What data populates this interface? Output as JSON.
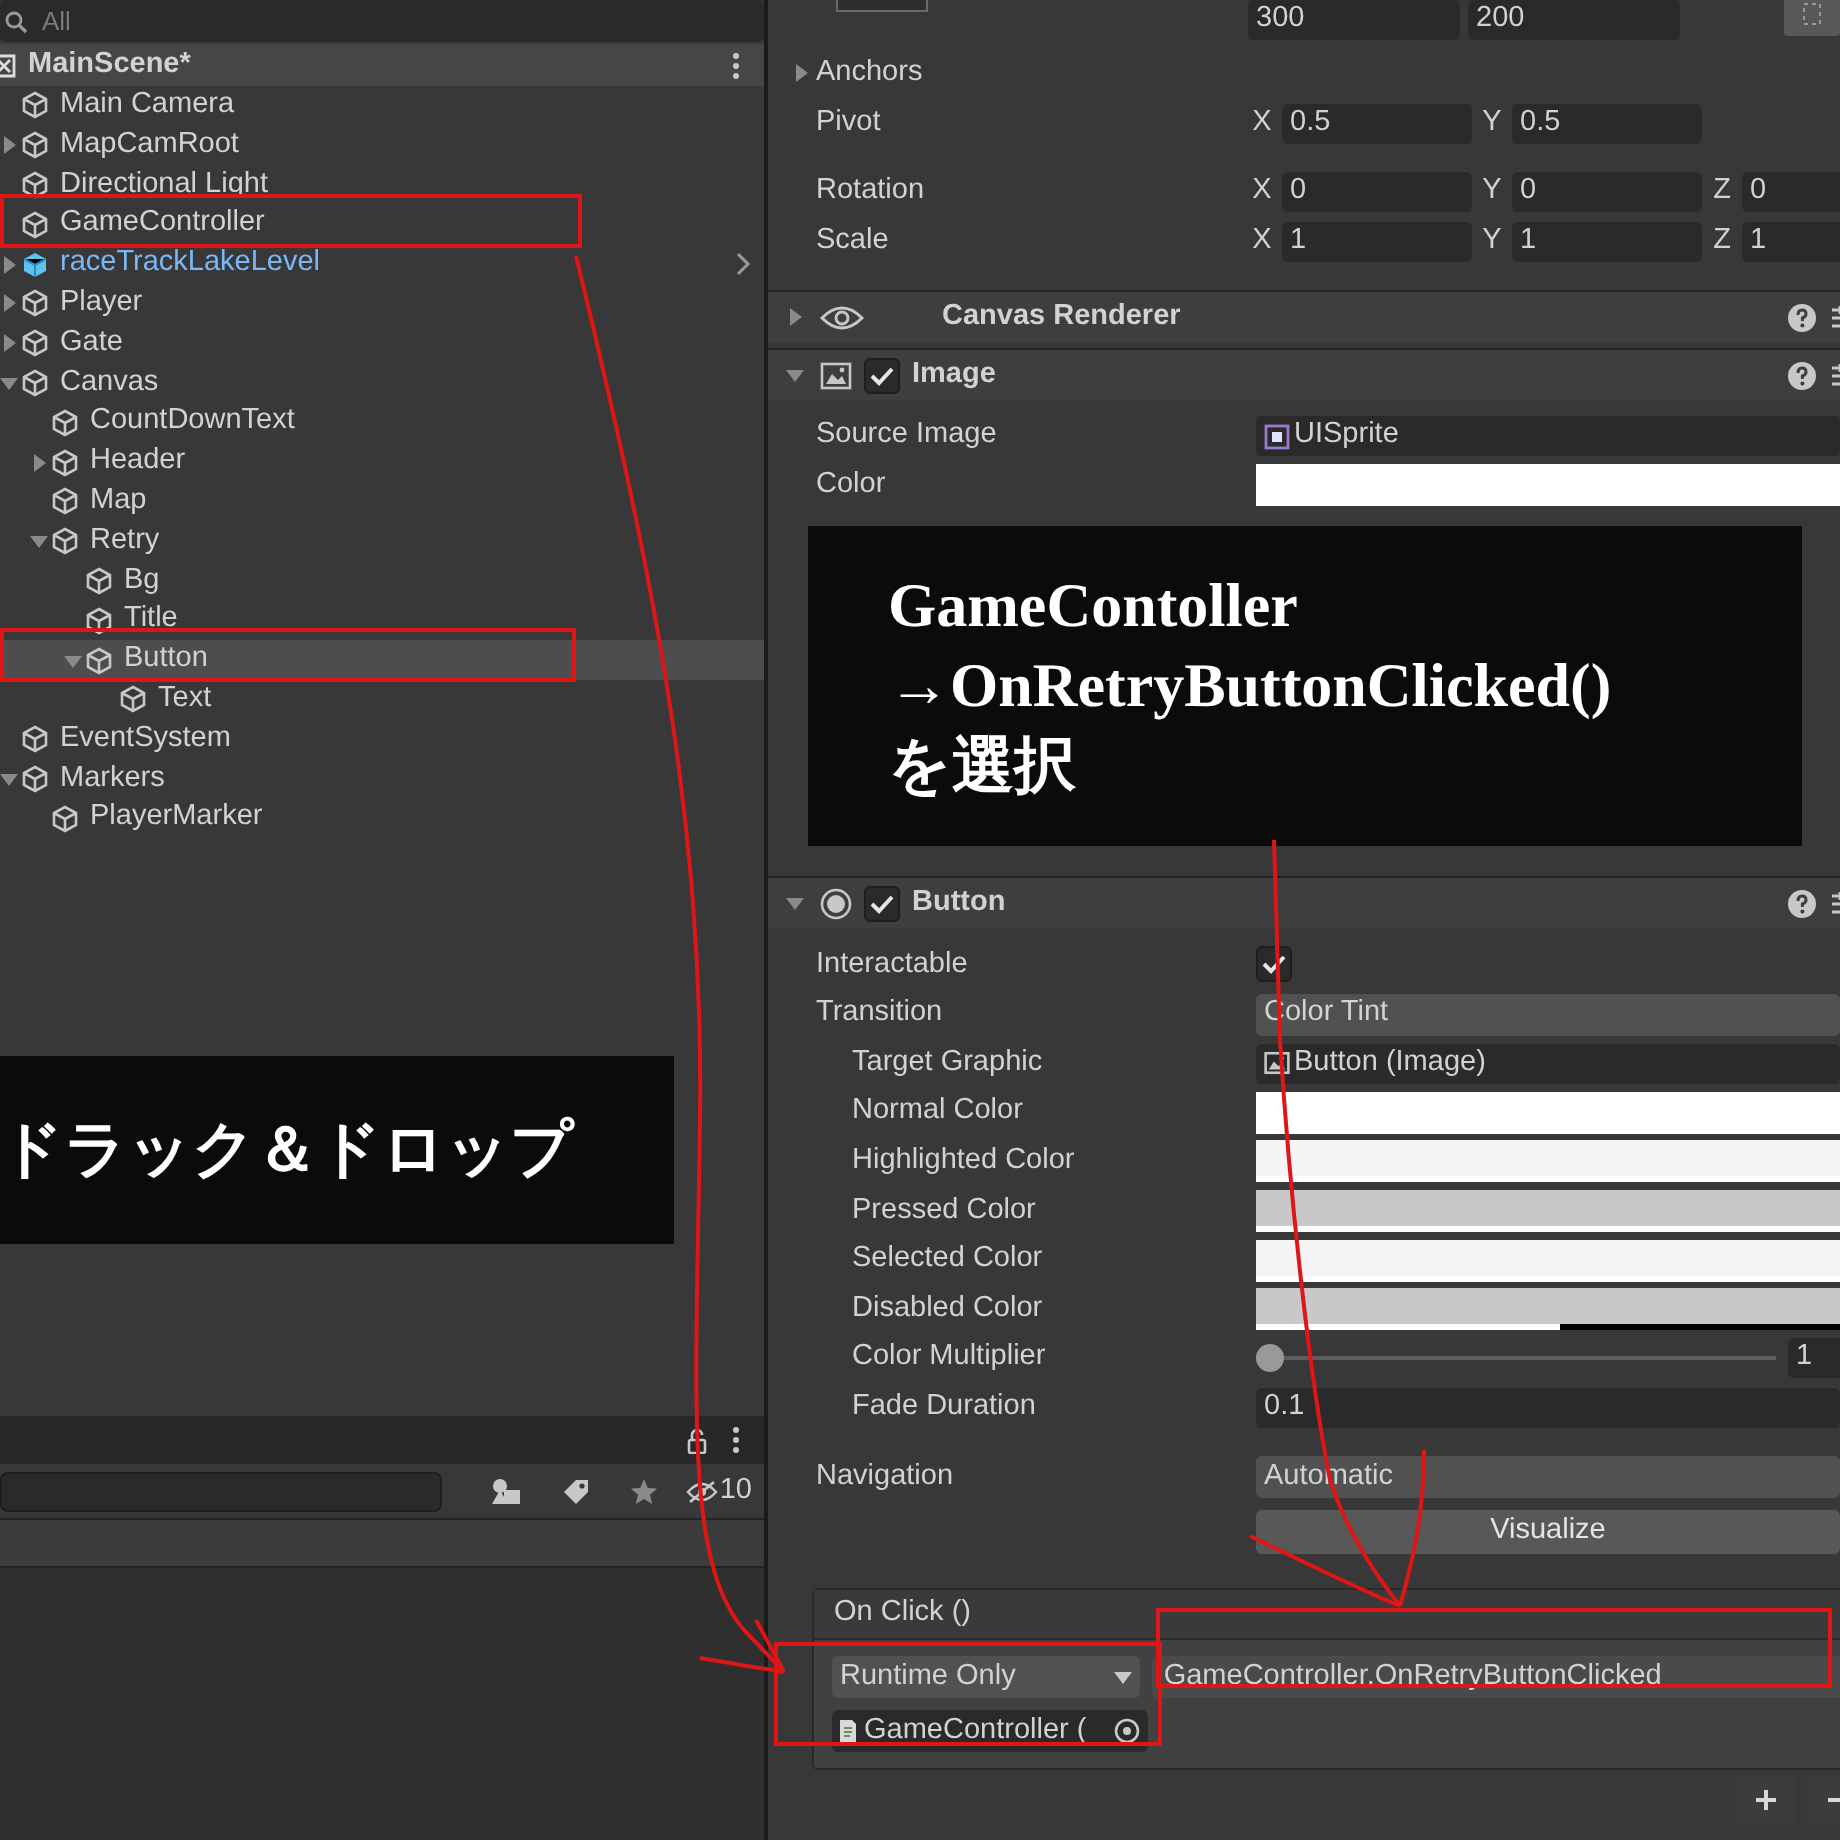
{
  "hierarchy": {
    "search": {
      "placeholder": "All"
    },
    "scene": {
      "title": "MainScene*"
    },
    "items": [
      {
        "label": "Main Camera",
        "kind": "object",
        "selected": false
      },
      {
        "label": "MapCamRoot",
        "kind": "object",
        "selected": false,
        "expanded": false
      },
      {
        "label": "Directional Light",
        "kind": "object",
        "selected": false
      },
      {
        "label": "GameController",
        "kind": "object",
        "selected": false
      },
      {
        "label": "raceTrackLakeLevel",
        "kind": "prefab",
        "selected": false,
        "expanded": false
      },
      {
        "label": "Player",
        "kind": "object",
        "selected": false,
        "expanded": false
      },
      {
        "label": "Gate",
        "kind": "object",
        "selected": false,
        "expanded": false
      },
      {
        "label": "Canvas",
        "kind": "object",
        "selected": false,
        "expanded": true,
        "children": [
          {
            "label": "CountDownText",
            "kind": "object",
            "selected": false
          },
          {
            "label": "Header",
            "kind": "object",
            "selected": false,
            "expanded": false
          },
          {
            "label": "Map",
            "kind": "object",
            "selected": false
          },
          {
            "label": "Retry",
            "kind": "object",
            "selected": false,
            "expanded": true,
            "children": [
              {
                "label": "Bg",
                "kind": "object",
                "selected": false
              },
              {
                "label": "Title",
                "kind": "object",
                "selected": false
              },
              {
                "label": "Button",
                "kind": "object",
                "selected": true,
                "expanded": true,
                "children": [
                  {
                    "label": "Text",
                    "kind": "object",
                    "selected": false
                  }
                ]
              }
            ]
          }
        ]
      },
      {
        "label": "EventSystem",
        "kind": "object",
        "selected": false
      },
      {
        "label": "Markers",
        "kind": "object",
        "selected": false,
        "expanded": true,
        "children": [
          {
            "label": "PlayerMarker",
            "kind": "object",
            "selected": false
          }
        ]
      }
    ],
    "annotation": {
      "lines": [
        "ドラック＆ドロップ"
      ]
    }
  },
  "project": {
    "hidden_count": "10"
  },
  "inspector": {
    "size_values": [
      "300",
      "200"
    ],
    "transform_rows": [
      {
        "label": "Anchors",
        "kind": "foldout"
      },
      {
        "label": "Pivot",
        "kind": "vector",
        "axes": [
          {
            "axis": "X",
            "value": "0.5"
          },
          {
            "axis": "Y",
            "value": "0.5"
          }
        ]
      },
      {
        "label": "Rotation",
        "kind": "vector",
        "axes": [
          {
            "axis": "X",
            "value": "0"
          },
          {
            "axis": "Y",
            "value": "0"
          },
          {
            "axis": "Z",
            "value": "0"
          }
        ]
      },
      {
        "label": "Scale",
        "kind": "vector",
        "axes": [
          {
            "axis": "X",
            "value": "1"
          },
          {
            "axis": "Y",
            "value": "1"
          },
          {
            "axis": "Z",
            "value": "1"
          }
        ]
      }
    ],
    "components": [
      {
        "title": "Canvas Renderer",
        "expanded": false
      },
      {
        "title": "Image",
        "enabled": true,
        "expanded": true,
        "rows": [
          {
            "kind": "object",
            "label": "Source Image",
            "value": "UISprite"
          },
          {
            "kind": "color",
            "label": "Color",
            "color": "#ffffff",
            "level": 1
          }
        ]
      },
      {
        "title": "Button",
        "enabled": true,
        "expanded": true,
        "rows": [
          {
            "kind": "checkbox",
            "label": "Interactable",
            "checked": true
          },
          {
            "kind": "dropdown",
            "label": "Transition",
            "value": "Color Tint"
          },
          {
            "kind": "object",
            "label": "Target Graphic",
            "value": "Button (Image)"
          },
          {
            "kind": "color",
            "label": "Normal Color",
            "color": "#ffffff",
            "level": 1
          },
          {
            "kind": "color",
            "label": "Highlighted Color",
            "color": "#f5f5f5",
            "level": 1
          },
          {
            "kind": "color",
            "label": "Pressed Color",
            "color": "#c8c8c8",
            "level": 1
          },
          {
            "kind": "color",
            "label": "Selected Color",
            "color": "#f5f5f5",
            "level": 1
          },
          {
            "kind": "color",
            "label": "Disabled Color",
            "color": "#c8c8c8",
            "level": 0.52
          },
          {
            "kind": "slider",
            "label": "Color Multiplier",
            "level": 0,
            "value": "1"
          },
          {
            "kind": "text",
            "label": "Fade Duration",
            "value": "0.1"
          },
          {
            "kind": "dropdown",
            "label": "Navigation",
            "value": "Automatic"
          },
          {
            "kind": "button",
            "value": "Visualize"
          }
        ]
      }
    ],
    "on_click": {
      "title": "On Click ()",
      "mode": "Runtime Only",
      "function": "GameController.OnRetryButtonClicked",
      "target": "GameController ("
    },
    "annotation": {
      "lines": [
        "GameContoller",
        "→OnRetryButtonClicked()",
        "を選択"
      ]
    }
  }
}
